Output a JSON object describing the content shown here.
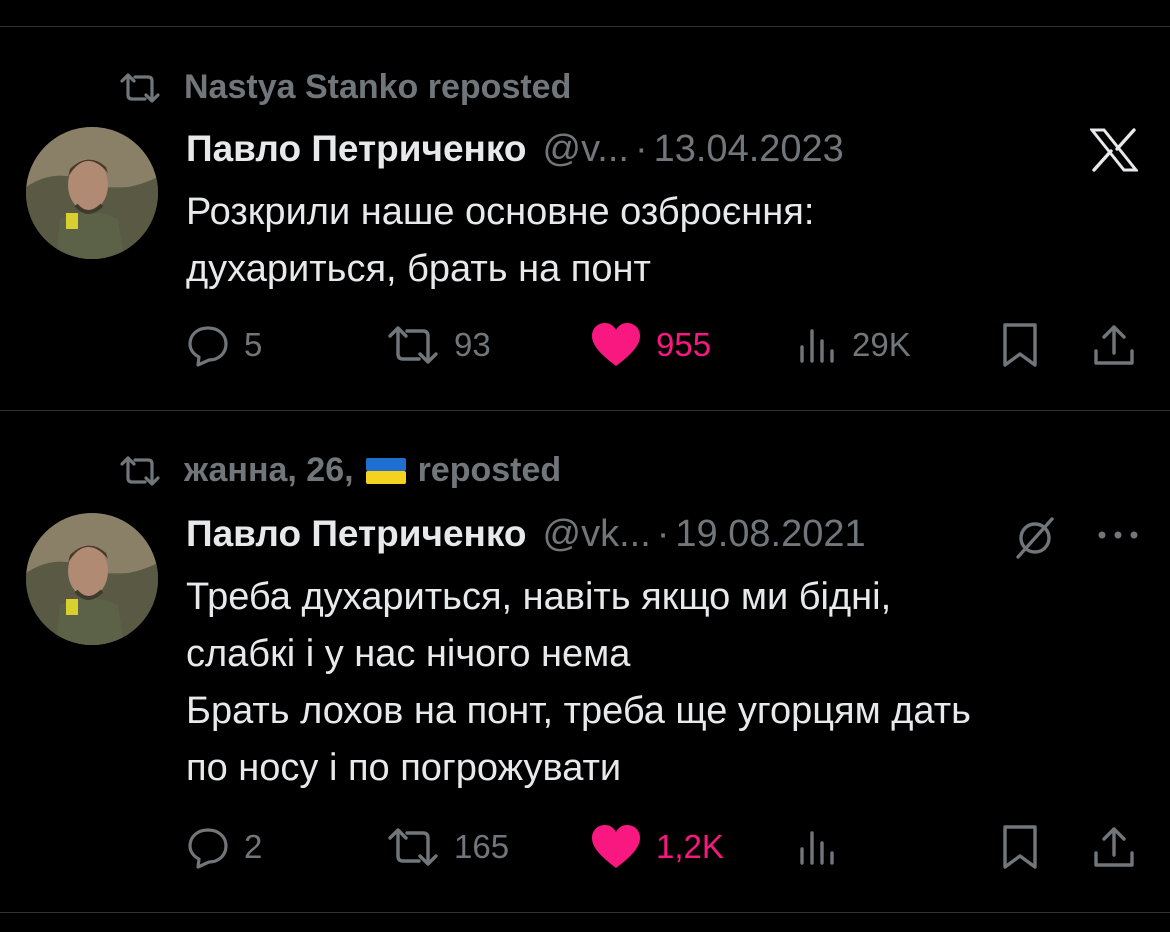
{
  "tweets": [
    {
      "repost_label": "Nastya Stanko reposted",
      "author_name": "Павло Петриченко",
      "handle": "@v...",
      "separator": "·",
      "date": "13.04.2023",
      "text": "Розкрили наше основне озброєння:\nдухариться, брать на понт",
      "corner_icon": "x-logo-icon",
      "replies": "5",
      "reposts": "93",
      "likes": "955",
      "views": "29K"
    },
    {
      "repost_label_prefix": "жанна, 26,",
      "repost_label_flag": "ukraine-flag-icon",
      "repost_label_suffix": "reposted",
      "author_name": "Павло Петриченко",
      "handle": "@vk...",
      "separator": "·",
      "date": "19.08.2021",
      "text": "Треба духариться, навіть якщо ми бідні,\nслабкі і у нас нічого нема\nБрать лохов на понт, треба ще угорцям дать\nпо носу і по погрожувати",
      "corner_icon": "grok-icon",
      "more_icon": "more-dots-icon",
      "replies": "2",
      "reposts": "165",
      "likes": "1,2K",
      "views": ""
    }
  ],
  "colors": {
    "background": "#000000",
    "text": "#e7e9ea",
    "muted": "#71767b",
    "like": "#f91880",
    "divider": "#2f3336"
  }
}
